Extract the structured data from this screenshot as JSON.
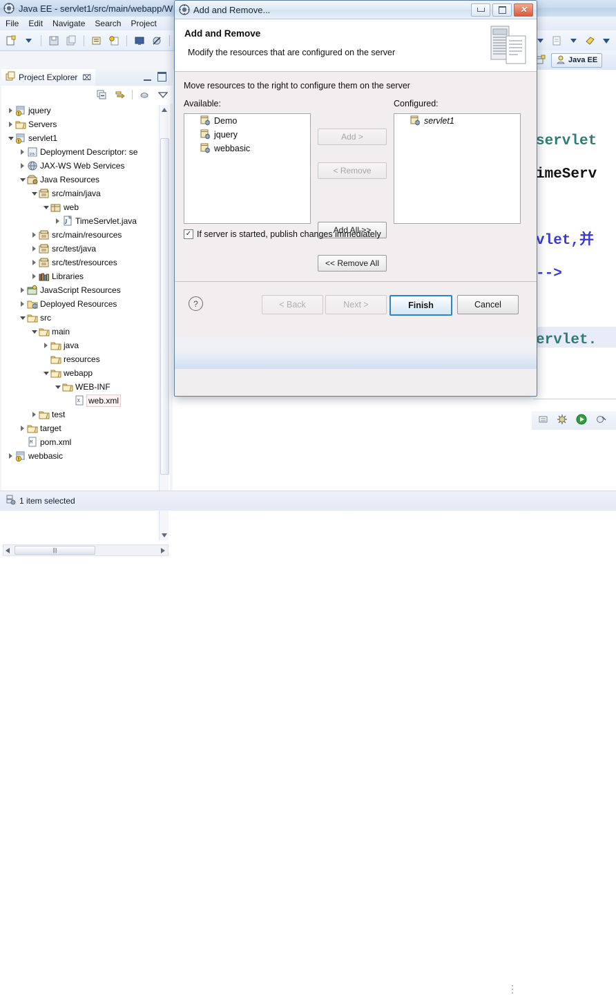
{
  "ide": {
    "title": "Java EE - servlet1/src/main/webapp/W",
    "app_icon": "eclipse-icon",
    "menu": [
      "File",
      "Edit",
      "Navigate",
      "Search",
      "Project"
    ],
    "perspective": {
      "label": "Java EE",
      "icon": "java-ee-perspective-icon"
    },
    "status": {
      "icon": "selection-icon",
      "text": "1 item selected"
    }
  },
  "explorer": {
    "tab_label": "Project Explorer",
    "tab_close": "⌧",
    "toolbar_icons": [
      "collapse-all-icon",
      "link-with-editor-icon",
      "view-menu-focus-icon",
      "view-menu-icon"
    ],
    "tree": [
      {
        "label": "jquery",
        "indent": 0,
        "state": "collapsed",
        "icon": "java-project-warning-icon"
      },
      {
        "label": "Servers",
        "indent": 0,
        "state": "collapsed",
        "icon": "folder-open-icon"
      },
      {
        "label": "servlet1",
        "indent": 0,
        "state": "expanded",
        "icon": "java-project-warning-icon"
      },
      {
        "label": "Deployment Descriptor: se",
        "indent": 1,
        "state": "collapsed",
        "icon": "deployment-descriptor-icon"
      },
      {
        "label": "JAX-WS Web Services",
        "indent": 1,
        "state": "collapsed",
        "icon": "jaxws-icon"
      },
      {
        "label": "Java Resources",
        "indent": 1,
        "state": "expanded",
        "icon": "java-resources-icon"
      },
      {
        "label": "src/main/java",
        "indent": 2,
        "state": "expanded",
        "icon": "source-folder-icon"
      },
      {
        "label": "web",
        "indent": 3,
        "state": "expanded",
        "icon": "package-icon"
      },
      {
        "label": "TimeServlet.java",
        "indent": 4,
        "state": "collapsed",
        "icon": "java-file-icon"
      },
      {
        "label": "src/main/resources",
        "indent": 2,
        "state": "collapsed",
        "icon": "source-folder-icon"
      },
      {
        "label": "src/test/java",
        "indent": 2,
        "state": "collapsed",
        "icon": "source-folder-icon"
      },
      {
        "label": "src/test/resources",
        "indent": 2,
        "state": "collapsed",
        "icon": "source-folder-icon"
      },
      {
        "label": "Libraries",
        "indent": 2,
        "state": "collapsed",
        "icon": "libraries-icon"
      },
      {
        "label": "JavaScript Resources",
        "indent": 1,
        "state": "collapsed",
        "icon": "javascript-resources-icon"
      },
      {
        "label": "Deployed Resources",
        "indent": 1,
        "state": "collapsed",
        "icon": "deployed-resources-icon"
      },
      {
        "label": "src",
        "indent": 1,
        "state": "expanded",
        "icon": "folder-icon"
      },
      {
        "label": "main",
        "indent": 2,
        "state": "expanded",
        "icon": "folder-icon"
      },
      {
        "label": "java",
        "indent": 3,
        "state": "collapsed",
        "icon": "folder-icon"
      },
      {
        "label": "resources",
        "indent": 3,
        "state": "leaf",
        "icon": "folder-icon"
      },
      {
        "label": "webapp",
        "indent": 3,
        "state": "expanded",
        "icon": "folder-icon"
      },
      {
        "label": "WEB-INF",
        "indent": 4,
        "state": "expanded",
        "icon": "folder-icon"
      },
      {
        "label": "web.xml",
        "indent": 5,
        "state": "leaf",
        "icon": "xml-file-icon",
        "selected": true
      },
      {
        "label": "test",
        "indent": 2,
        "state": "collapsed",
        "icon": "folder-icon"
      },
      {
        "label": "target",
        "indent": 1,
        "state": "collapsed",
        "icon": "folder-icon"
      },
      {
        "label": "pom.xml",
        "indent": 1,
        "state": "leaf",
        "icon": "maven-pom-icon"
      },
      {
        "label": "webbasic",
        "indent": 0,
        "state": "collapsed",
        "icon": "java-project-warning-icon"
      }
    ]
  },
  "editor": {
    "code_lines": [
      {
        "text": "servlet",
        "color": "teal"
      },
      {
        "text": "imeServ",
        "color": "dark"
      },
      {
        "text": "",
        "color": "dark"
      },
      {
        "text": "vlet,并",
        "color": "blue"
      },
      {
        "text": "-->",
        "color": "blue"
      },
      {
        "text": "",
        "color": "dark"
      },
      {
        "text": "ervlet.",
        "color": "teal"
      }
    ],
    "servers_toolbar_icons": [
      "properties-icon",
      "debug-icon",
      "start-icon",
      "profile-icon",
      "stop-icon"
    ]
  },
  "dialog": {
    "titlebar": {
      "icon": "eclipse-icon",
      "title": "Add and Remove...",
      "minimize": "minimize-button",
      "maximize": "maximize-button",
      "close": "close-button",
      "close_glyph": "✕"
    },
    "header": {
      "title": "Add and Remove",
      "subtitle": "Modify the resources that are configured on the server",
      "banner_icon": "server-resources-banner-icon"
    },
    "intro": "Move resources to the right to configure them on the server",
    "available": {
      "label": "Available:",
      "items": [
        {
          "name": "Demo",
          "icon": "web-module-icon"
        },
        {
          "name": "jquery",
          "icon": "web-module-icon"
        },
        {
          "name": "webbasic",
          "icon": "web-module-icon"
        }
      ]
    },
    "configured": {
      "label": "Configured:",
      "items": [
        {
          "name": "servlet1",
          "icon": "web-module-icon",
          "italic": true
        }
      ]
    },
    "transfer_buttons": [
      {
        "label": "Add >",
        "enabled": false,
        "name": "add-button"
      },
      {
        "label": "< Remove",
        "enabled": false,
        "name": "remove-button"
      },
      {
        "label": "Add All >>",
        "enabled": true,
        "name": "add-all-button"
      },
      {
        "label": "<< Remove All",
        "enabled": true,
        "name": "remove-all-button"
      }
    ],
    "publish_checkbox": {
      "label": "If server is started, publish changes immediately",
      "checked": true,
      "glyph": "✓"
    },
    "footer": {
      "help": "?",
      "back": {
        "label": "< Back",
        "enabled": false
      },
      "next": {
        "label": "Next >",
        "enabled": false
      },
      "finish": {
        "label": "Finish",
        "enabled": true,
        "default": true
      },
      "cancel": {
        "label": "Cancel",
        "enabled": true
      }
    }
  },
  "colors": {
    "accent": "#2f84c8",
    "titlebar": "#d2e1f1",
    "dialog_bg": "#f2eeef",
    "close_button": "#d9583a",
    "code_teal": "#2e7d74",
    "code_blue": "#3b3bc9"
  }
}
